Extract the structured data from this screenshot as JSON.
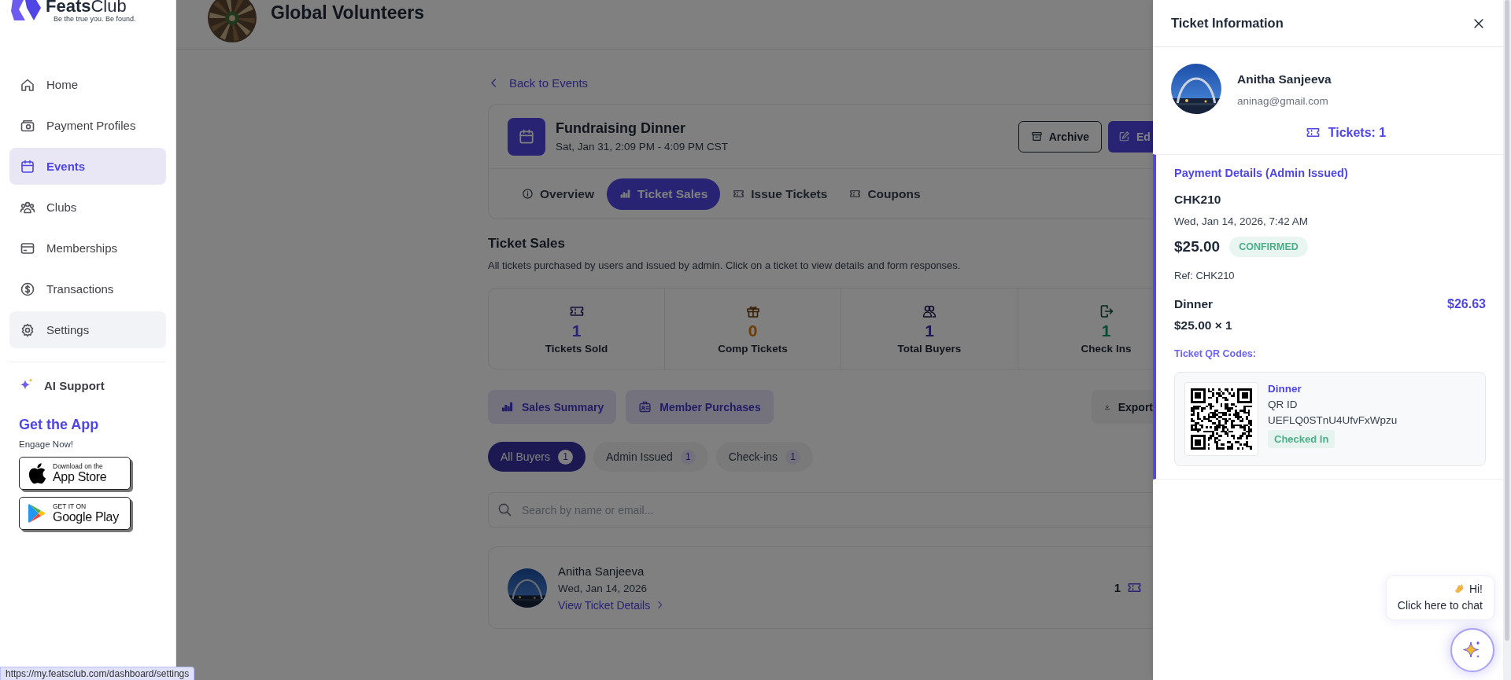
{
  "sidebar": {
    "logo": "**Feats**Club",
    "tagline": "Be the true you. Be found.",
    "items": [
      {
        "label": "Home",
        "selected": false,
        "hovered": false
      },
      {
        "label": "Payment Profiles",
        "selected": false,
        "hovered": false
      },
      {
        "label": "Events",
        "selected": true,
        "hovered": false
      },
      {
        "label": "Clubs",
        "selected": false,
        "hovered": false
      },
      {
        "label": "Memberships",
        "selected": false,
        "hovered": false
      },
      {
        "label": "Transactions",
        "selected": false,
        "hovered": false
      },
      {
        "label": "Settings",
        "selected": false,
        "hovered": true
      }
    ],
    "ai_support": "AI Support",
    "get_app": "Get the App",
    "engage": "Engage Now!",
    "badges": [
      {
        "kind": "apple",
        "small": "Download on the",
        "big": "App Store"
      },
      {
        "kind": "google",
        "small": "GET IT ON",
        "big": "Google Play"
      }
    ]
  },
  "header": {
    "org_name": "Global Volunteers"
  },
  "back_link": "Back to Events",
  "event": {
    "title": "Fundraising Dinner",
    "when": "Sat, Jan 31, 2:09 PM - 4:09 PM CST",
    "actions": [
      {
        "label": "Archive",
        "kind": "outline"
      },
      {
        "label": "Ed",
        "kind": "primary"
      }
    ],
    "tabs": [
      {
        "label": "Overview",
        "selected": false
      },
      {
        "label": "Ticket Sales",
        "selected": true
      },
      {
        "label": "Issue Tickets",
        "selected": false
      },
      {
        "label": "Coupons",
        "selected": false
      }
    ]
  },
  "ticket_sales": {
    "title": "Ticket Sales",
    "description": "All tickets purchased by users and issued by admin. Click on a ticket to view details and form responses.",
    "stats": [
      {
        "value": "1",
        "label": "Tickets Sold",
        "color": "#282373"
      },
      {
        "value": "0",
        "label": "Comp Tickets",
        "color": "#6d3b03"
      },
      {
        "value": "1",
        "label": "Total Buyers",
        "color": "#1c1852"
      },
      {
        "value": "1",
        "label": "Check Ins",
        "color": "#034d35"
      }
    ],
    "views": [
      "Sales Summary",
      "Member Purchases"
    ],
    "export": "Export",
    "filters": [
      {
        "label": "All Buyers",
        "count": "1",
        "selected": true
      },
      {
        "label": "Admin Issued",
        "count": "1",
        "selected": false
      },
      {
        "label": "Check-ins",
        "count": "1",
        "selected": false
      }
    ],
    "search": {
      "placeholder": "Search by name or email..."
    },
    "buyers": [
      {
        "name": "Anitha Sanjeeva",
        "date": "Wed, Jan 14, 2026",
        "link": "View Ticket Details",
        "tickets": "1"
      }
    ]
  },
  "ticket_panel": {
    "title": "Ticket Information",
    "user": {
      "name": "Anitha Sanjeeva",
      "email": "aninag@gmail.com"
    },
    "tickets": "Tickets: 1",
    "payment": {
      "title": "Payment Details (Admin Issued)",
      "code": "CHK210",
      "date": "Wed, Jan 14, 2026, 7:42 AM",
      "amount": "$25.00",
      "status": "CONFIRMED",
      "ref": "Ref: CHK210",
      "items": [
        {
          "name": "Dinner",
          "total": "$26.63",
          "price": "$25.00 × 1"
        }
      ],
      "qr_title": "Ticket QR Codes:",
      "qr_codes": [
        {
          "name": "Dinner",
          "id_label": "QR ID",
          "id": "UEFLQ0STnU4UfvFxWpzu",
          "status": "Checked In"
        }
      ]
    }
  },
  "chat": {
    "greeting": "Hi!",
    "prompt": "Click here to chat"
  },
  "status_url": "https://my.featsclub.com/dashboard/settings"
}
